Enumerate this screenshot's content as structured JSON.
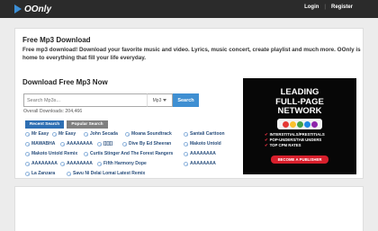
{
  "header": {
    "logo_text": "OOnly",
    "logo_icon": "play-triangle-icon",
    "nav": [
      {
        "label": "Login"
      },
      {
        "label": "Register"
      }
    ]
  },
  "main": {
    "title": "Free Mp3 Download",
    "description": "Free mp3 download! Download your favorite music and video. Lyrics, music concert, create playlist and much more. OOnly is home to everything that fill your life everyday.",
    "subtitle": "Download Free Mp3 Now",
    "search": {
      "placeholder": "Search Mp3s...",
      "type_value": "Mp3",
      "button_label": "Search"
    },
    "overall_downloads": "Overall Downloads: 204,466",
    "tabs": [
      {
        "label": "Recent Search",
        "active": true
      },
      {
        "label": "Popular Search",
        "active": false
      }
    ],
    "recent_searches": [
      "Mr Easy",
      "Mr Easy",
      "John Secada",
      "Moana Soundtrack",
      "Santali Carttoon",
      "MAWABHA",
      "AAAAAAAA",
      "[][][]",
      "Dive By Ed Sheeran",
      "Makoto Untold",
      "Makoto Untold Remix",
      "Curtis Stinger And The Forest Rangers",
      "AAAAAAAA",
      "AAAAAAAA",
      "AAAAAAAA",
      "Fifth Harmony Dope",
      "AAAAAAAA",
      "La Zanzara",
      "Savu Ni Delai Lomai Latest Remix"
    ]
  },
  "ad": {
    "headline": [
      "LEADING",
      "FULL-PAGE",
      "NETWORK"
    ],
    "features": [
      "INTERSTITIALS/PRESTITIALS",
      "POP-UNDERS/TAB UNDERS",
      "TOP CPM RATES"
    ],
    "cta": "BECOME A PUBLISHER",
    "logo_colors": [
      "#e53935",
      "#fbc02d",
      "#43a047",
      "#1e88e5",
      "#8e24aa"
    ]
  },
  "colors": {
    "topbar": "#2b2b2b",
    "accent": "#3f8fd2",
    "tab_active": "#2e6fb3",
    "tab_inactive": "#7f7f7f",
    "link": "#2a4f7d",
    "ad_red": "#d81f2c"
  }
}
